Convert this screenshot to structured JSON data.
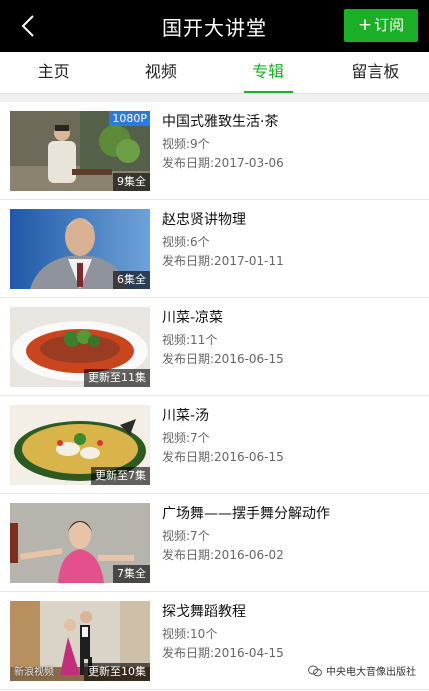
{
  "header": {
    "title": "国开大讲堂",
    "subscribe_label": "订阅"
  },
  "tabs": [
    {
      "label": "主页",
      "active": false
    },
    {
      "label": "视频",
      "active": false
    },
    {
      "label": "专辑",
      "active": true
    },
    {
      "label": "留言板",
      "active": false
    }
  ],
  "albums": [
    {
      "title": "中国式雅致生活·茶",
      "videos": "视频:9个",
      "date": "发布日期:2017-03-06",
      "count": "9集全",
      "badge": "1080P"
    },
    {
      "title": "赵忠贤讲物理",
      "videos": "视频:6个",
      "date": "发布日期:2017-01-11",
      "count": "6集全"
    },
    {
      "title": "川菜-凉菜",
      "videos": "视频:11个",
      "date": "发布日期:2016-06-15",
      "count": "更新至11集"
    },
    {
      "title": "川菜-汤",
      "videos": "视频:7个",
      "date": "发布日期:2016-06-15",
      "count": "更新至7集"
    },
    {
      "title": "广场舞——摆手舞分解动作",
      "videos": "视频:7个",
      "date": "发布日期:2016-06-02",
      "count": "7集全"
    },
    {
      "title": "探戈舞蹈教程",
      "videos": "视频:10个",
      "date": "发布日期:2016-04-15",
      "count": "更新至10集"
    }
  ],
  "watermark": {
    "left": "新浪视频",
    "right": "中央电大音像出版社"
  },
  "colors": {
    "accent": "#1aaf26",
    "topbar": "#000000"
  }
}
